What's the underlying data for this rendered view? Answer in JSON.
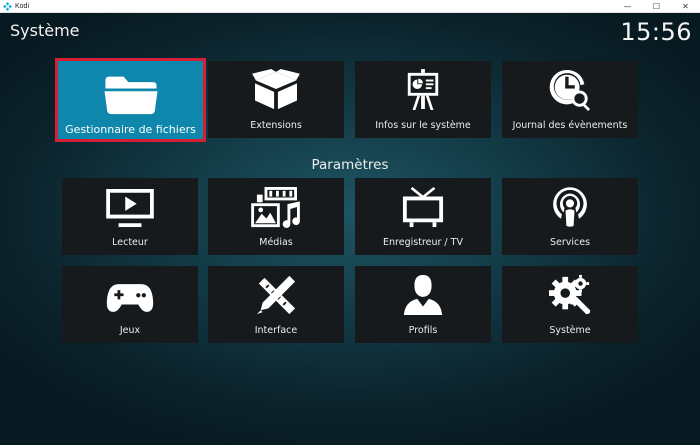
{
  "window": {
    "title": "Kodi",
    "minimize_glyph": "—",
    "maximize_glyph": "☐",
    "close_glyph": "✕"
  },
  "header": {
    "title": "Système",
    "clock": "15:56"
  },
  "top_tiles": [
    {
      "label": "Gestionnaire de fichiers",
      "icon": "folder-icon",
      "focused": true
    },
    {
      "label": "Extensions",
      "icon": "box-icon"
    },
    {
      "label": "Infos sur le système",
      "icon": "presentation-icon"
    },
    {
      "label": "Journal des évènements",
      "icon": "clock-search-icon"
    }
  ],
  "settings": {
    "title": "Paramètres",
    "row1": [
      {
        "label": "Lecteur",
        "icon": "tv-play-icon"
      },
      {
        "label": "Médias",
        "icon": "media-library-icon"
      },
      {
        "label": "Enregistreur / TV",
        "icon": "retro-tv-icon"
      },
      {
        "label": "Services",
        "icon": "podcast-icon"
      }
    ],
    "row2": [
      {
        "label": "Jeux",
        "icon": "gamepad-icon"
      },
      {
        "label": "Interface",
        "icon": "pencil-ruler-icon"
      },
      {
        "label": "Profils",
        "icon": "user-icon"
      },
      {
        "label": "Système",
        "icon": "gears-icon"
      }
    ]
  },
  "colors": {
    "focus_fill": "#0f87ad",
    "focus_border": "#d41f34",
    "tile_bg": "#161a1d",
    "kodi_blue": "#17b2e7"
  }
}
